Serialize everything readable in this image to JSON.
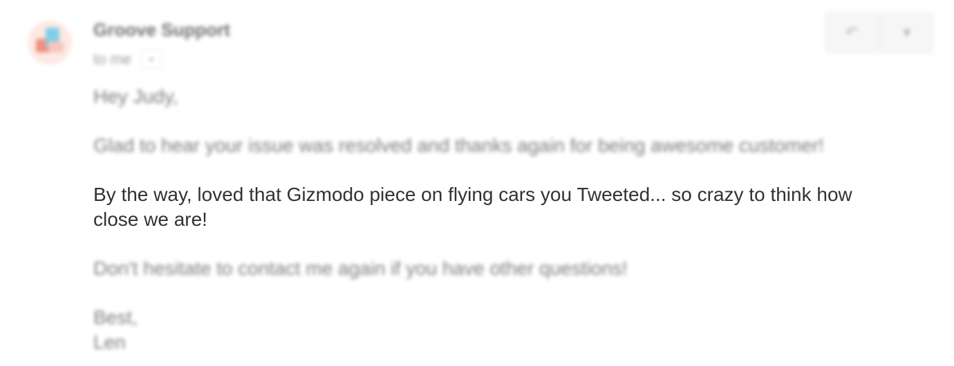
{
  "message": {
    "sender_name": "Groove Support",
    "recipient_label": "to me",
    "details_toggle_glyph": "▾",
    "actions": {
      "reply_glyph": "↶",
      "more_glyph": "▾"
    },
    "body": {
      "greeting": "Hey Judy,",
      "line_resolved": "Glad to hear your issue was resolved and thanks again for being awesome customer!",
      "line_personal": "By the way, loved that Gizmodo piece on flying cars you Tweeted... so crazy to think how close we are!",
      "line_contact": "Don't hesitate to contact me again if you have other questions!",
      "closing": "Best,",
      "signature": "Len"
    }
  },
  "colors": {
    "text_primary": "#2f3237",
    "text_blurred": "#7a7c80",
    "avatar_teal": "#7fd0e6",
    "avatar_coral": "#f08f7f"
  }
}
